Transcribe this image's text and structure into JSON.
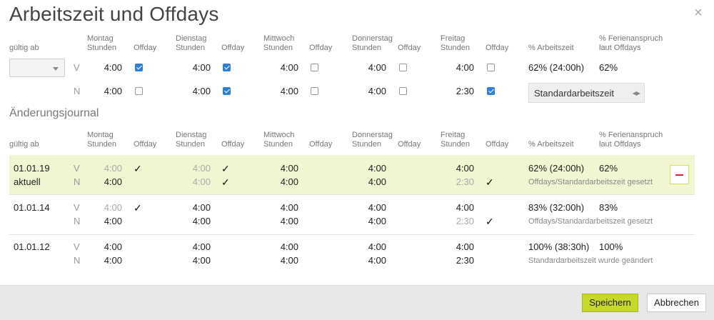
{
  "dialog": {
    "title": "Arbeitszeit und Offdays",
    "close_label": "×"
  },
  "headers": {
    "gueltig_ab": "gültig ab",
    "montag": "Montag",
    "dienstag": "Dienstag",
    "mittwoch": "Mittwoch",
    "donnerstag": "Donnerstag",
    "freitag": "Freitag",
    "stunden": "Stunden",
    "offday": "Offday",
    "arbeitszeit": "% Arbeitszeit",
    "ferien1": "% Ferienanspruch",
    "ferien2": "laut Offdays"
  },
  "editor": {
    "date_value": "",
    "rows": [
      {
        "label": "V",
        "hours": [
          "4:00",
          "4:00",
          "4:00",
          "4:00",
          "4:00"
        ],
        "offday": [
          true,
          true,
          false,
          false,
          false
        ]
      },
      {
        "label": "N",
        "hours": [
          "4:00",
          "4:00",
          "4:00",
          "4:00",
          "2:30"
        ],
        "offday": [
          false,
          true,
          false,
          false,
          true
        ]
      }
    ],
    "arbeitszeit": "62% (24:00h)",
    "ferien": "62%",
    "standard_select": "Standardarbeitszeit"
  },
  "journal": {
    "title": "Änderungsjournal",
    "entries": [
      {
        "date": "01.01.19",
        "sub": "aktuell",
        "v": [
          "4:00",
          "4:00",
          "4:00",
          "4:00",
          "4:00"
        ],
        "n": [
          "4:00",
          "4:00",
          "4:00",
          "4:00",
          "2:30"
        ],
        "check_v": [
          "✓",
          "✓",
          "",
          "",
          ""
        ],
        "check_n": [
          "",
          "✓",
          "",
          "",
          "✓"
        ],
        "arbeitszeit": "62% (24:00h)",
        "ferien": "62%",
        "note": "Offdays/Standardarbeitszeit gesetzt"
      },
      {
        "date": "01.01.14",
        "sub": "",
        "v": [
          "4:00",
          "4:00",
          "4:00",
          "4:00",
          "4:00"
        ],
        "n": [
          "4:00",
          "4:00",
          "4:00",
          "4:00",
          "2:30"
        ],
        "check_v": [
          "✓",
          "",
          "",
          "",
          ""
        ],
        "check_n": [
          "",
          "",
          "",
          "",
          "✓"
        ],
        "arbeitszeit": "83% (32:00h)",
        "ferien": "83%",
        "note": "Offdays/Standardarbeitszeit gesetzt"
      },
      {
        "date": "01.01.12",
        "sub": "",
        "v": [
          "4:00",
          "4:00",
          "4:00",
          "4:00",
          "4:00"
        ],
        "n": [
          "4:00",
          "4:00",
          "4:00",
          "4:00",
          "2:30"
        ],
        "check_v": [
          "",
          "",
          "",
          "",
          ""
        ],
        "check_n": [
          "",
          "",
          "",
          "",
          ""
        ],
        "arbeitszeit": "100% (38:30h)",
        "ferien": "100%",
        "note": "Standardarbeitszeit wurde geändert"
      }
    ]
  },
  "footer": {
    "save_label": "Speichern",
    "cancel_label": "Abbrechen"
  },
  "colors": {
    "accent": "#c6d82a",
    "highlight_row": "#f1f5d2",
    "checkbox": "#2f7fd7"
  }
}
